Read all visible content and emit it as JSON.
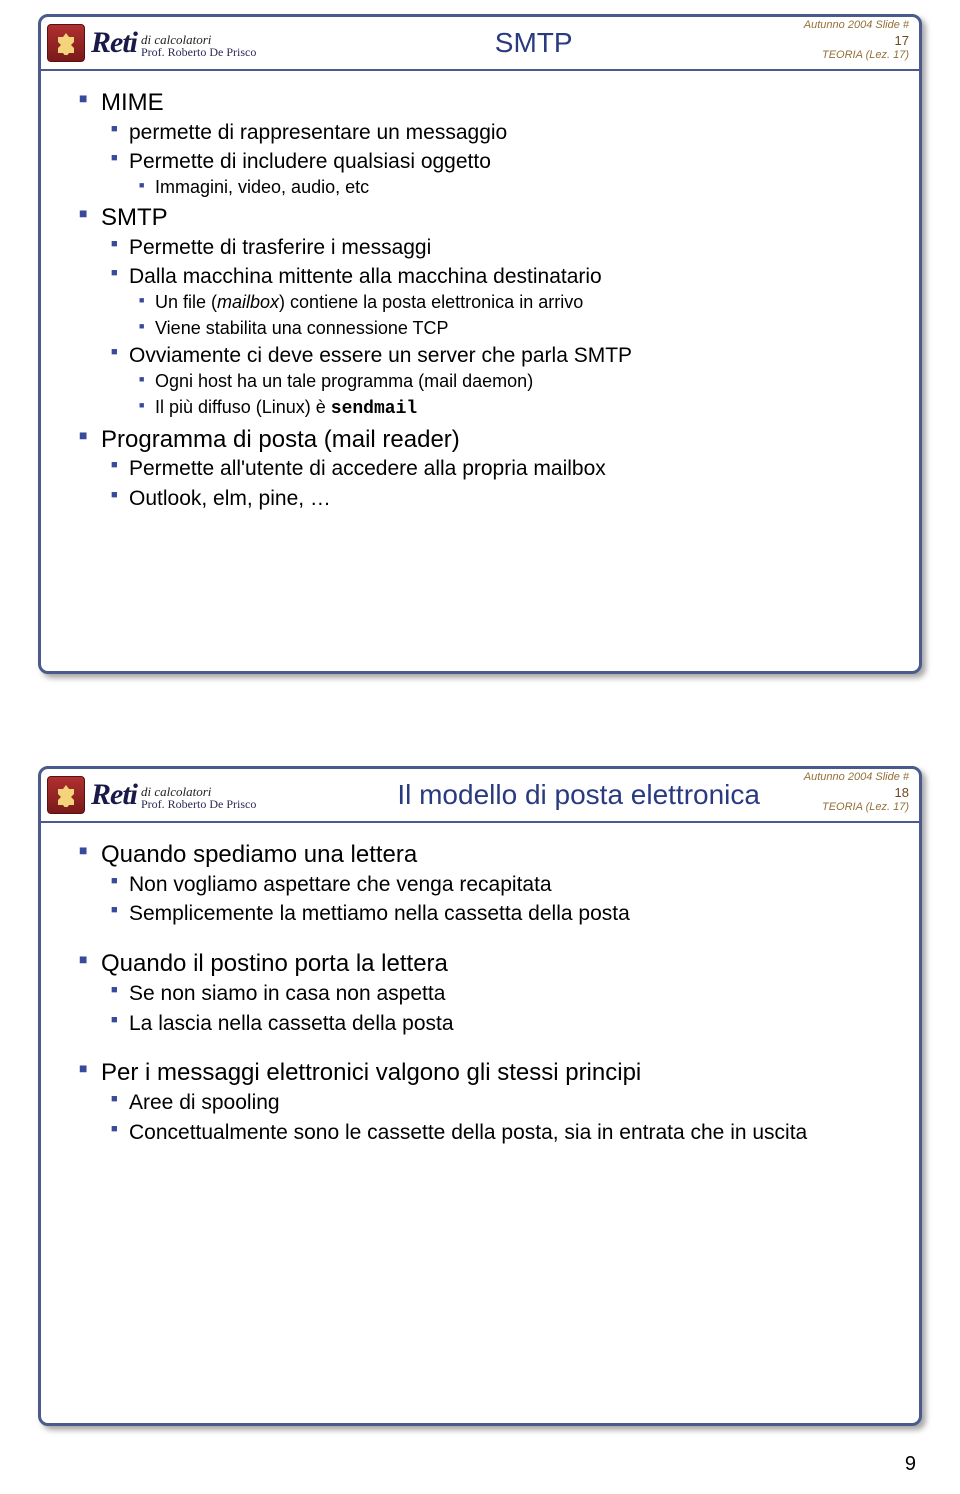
{
  "logo": {
    "reti": "Reti",
    "sub1": "di calcolatori",
    "sub2": "Prof. Roberto De Prisco"
  },
  "slide1": {
    "title": "SMTP",
    "meta_top": "Autunno 2004 Slide #",
    "meta_num": "17",
    "meta_lez": "TEORIA (Lez. 17)",
    "b1": "MIME",
    "b1_1": "permette di rappresentare un messaggio",
    "b1_2": "Permette di includere qualsiasi oggetto",
    "b1_2_1": "Immagini, video, audio, etc",
    "b2": "SMTP",
    "b2_1": "Permette di trasferire i messaggi",
    "b2_2": "Dalla macchina mittente alla macchina destinatario",
    "b2_2_1a": "Un file (",
    "b2_2_1b": "mailbox",
    "b2_2_1c": ") contiene la posta elettronica in arrivo",
    "b2_2_2": "Viene stabilita una connessione TCP",
    "b2_3": "Ovviamente ci deve essere un server che parla SMTP",
    "b2_3_1": "Ogni host ha un tale programma (mail daemon)",
    "b2_3_2a": "Il più diffuso (Linux) è ",
    "b2_3_2b": "sendmail",
    "b3": "Programma di posta (mail reader)",
    "b3_1": "Permette all'utente di accedere alla propria mailbox",
    "b3_2": "Outlook, elm, pine, …"
  },
  "slide2": {
    "title": "Il modello di posta elettronica",
    "meta_top": "Autunno 2004 Slide #",
    "meta_num": "18",
    "meta_lez": "TEORIA (Lez. 17)",
    "b1": "Quando spediamo una lettera",
    "b1_1": "Non vogliamo aspettare che venga recapitata",
    "b1_2": "Semplicemente la mettiamo nella cassetta della posta",
    "b2": "Quando il postino porta la lettera",
    "b2_1": "Se non siamo in casa non aspetta",
    "b2_2": "La lascia nella cassetta della posta",
    "b3": "Per i messaggi elettronici valgono gli stessi principi",
    "b3_1": "Aree di spooling",
    "b3_2": "Concettualmente sono le cassette della posta, sia in entrata che in uscita"
  },
  "page_number": "9"
}
